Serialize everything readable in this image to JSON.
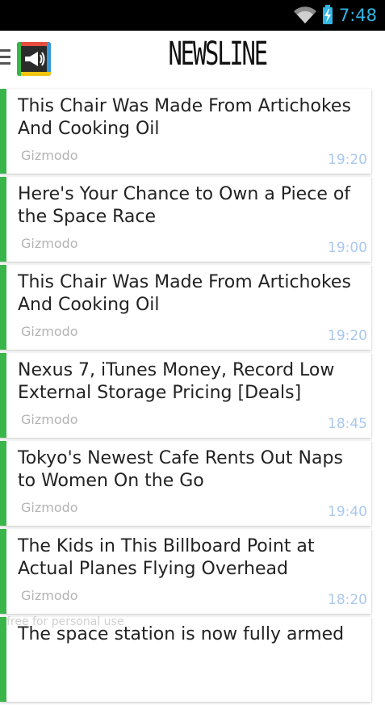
{
  "status_bar": {
    "time": "7:48",
    "icons": [
      "wifi-icon",
      "battery-charging-icon"
    ],
    "accent_color": "#33b5e5"
  },
  "app_bar": {
    "title": "NEWSLINE",
    "menu_icon": "hamburger-menu-icon",
    "logo_icon": "megaphone-icon"
  },
  "colors": {
    "card_accent": "#39b54a",
    "time_text": "#a9c8ef",
    "source_text": "#b3b3b3"
  },
  "articles": [
    {
      "title": "This Chair Was Made From Artichokes And Cooking Oil",
      "source": "Gizmodo",
      "time": "19:20"
    },
    {
      "title": "Here's Your Chance to Own a Piece of the Space Race",
      "source": "Gizmodo",
      "time": "19:00"
    },
    {
      "title": "This Chair Was Made From Artichokes And Cooking Oil",
      "source": "Gizmodo",
      "time": "19:20"
    },
    {
      "title": "Nexus 7, iTunes Money, Record Low External Storage Pricing [Deals]",
      "source": "Gizmodo",
      "time": "18:45"
    },
    {
      "title": "Tokyo's Newest Cafe Rents Out Naps to Women On the Go",
      "source": "Gizmodo",
      "time": "19:40"
    },
    {
      "title": "The Kids in This Billboard Point at Actual Planes Flying Overhead",
      "source": "Gizmodo",
      "time": "18:20"
    },
    {
      "title": "The space station is now fully armed",
      "source": "",
      "time": ""
    }
  ],
  "watermark": "free for personal use"
}
